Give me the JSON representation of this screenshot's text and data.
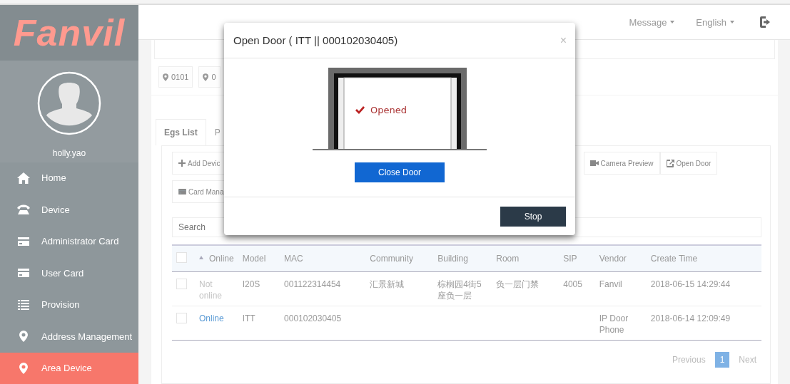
{
  "sidebar": {
    "logo": "Fanvil",
    "username": "holly.yao",
    "items": [
      {
        "label": "Home",
        "selected": false
      },
      {
        "label": "Device",
        "selected": false
      },
      {
        "label": "Administrator Card",
        "selected": false
      },
      {
        "label": "User Card",
        "selected": false
      },
      {
        "label": "Provision",
        "selected": false
      },
      {
        "label": "Address Management",
        "selected": false
      },
      {
        "label": "Area Device",
        "selected": true
      }
    ]
  },
  "topbar": {
    "menus": [
      {
        "label": "Message"
      },
      {
        "label": "English"
      }
    ]
  },
  "location_tags": [
    {
      "label": "0101"
    },
    {
      "label": "0"
    }
  ],
  "tabs": [
    {
      "label": "Egs List",
      "selected": true
    },
    {
      "label": "P",
      "selected": false
    }
  ],
  "toolbar": {
    "rows": [
      {
        "buttons": [
          {
            "label": "Add Devic"
          },
          {
            "label": "Camera Preview"
          },
          {
            "label": "Open Door"
          }
        ]
      },
      {
        "buttons": [
          {
            "label": "Card Mana"
          }
        ]
      }
    ]
  },
  "search": {
    "placeholder": "Search"
  },
  "table": {
    "header_checked": false,
    "columns": [
      {
        "label": "Online",
        "sorted": true
      },
      {
        "label": "Model",
        "sorted": false
      },
      {
        "label": "MAC",
        "sorted": false
      },
      {
        "label": "Community",
        "sorted": false
      },
      {
        "label": "Building",
        "sorted": false
      },
      {
        "label": "Room",
        "sorted": false
      },
      {
        "label": "SIP",
        "sorted": false
      },
      {
        "label": "Vendor",
        "sorted": false
      },
      {
        "label": "Create Time",
        "sorted": false
      }
    ],
    "rows": [
      {
        "checked": false,
        "online": false,
        "cells": [
          "Not online",
          "I20S",
          "001122314454",
          "汇景新城",
          "棕榈园4街5座负一层",
          "负一层门禁",
          "4005",
          "Fanvil",
          "2018-06-15 14:29:44"
        ]
      },
      {
        "checked": false,
        "online": true,
        "cells": [
          "Online",
          "ITT",
          "000102030405",
          "",
          "",
          "",
          "",
          "IP Door Phone",
          "2018-06-14 12:09:49"
        ]
      }
    ]
  },
  "pagination": {
    "previous": "Previous",
    "next": "Next",
    "pages": [
      {
        "label": "1",
        "selected": true
      }
    ]
  },
  "modal": {
    "title": "Open Door ( ITT || 000102030405)",
    "close": "×",
    "status": "Opened",
    "primary_button": "Close Door",
    "footer_button": "Stop"
  }
}
